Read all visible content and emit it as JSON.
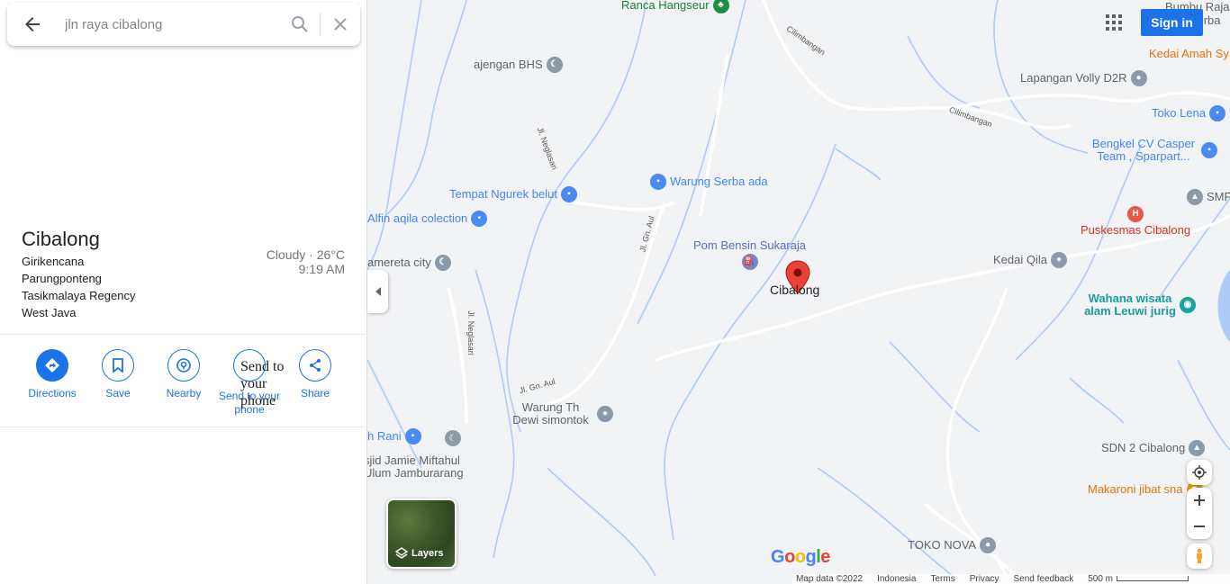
{
  "search": {
    "query": "jln raya cibalong"
  },
  "place": {
    "title": "Cibalong",
    "address_lines": [
      "Girikencana",
      "Parungponteng",
      "Tasikmalaya Regency",
      "West Java"
    ],
    "weather": "Cloudy · 26°C",
    "time": "9:19 AM"
  },
  "actions": [
    {
      "label": "Directions",
      "icon": "directions-icon"
    },
    {
      "label": "Save",
      "icon": "bookmark-icon"
    },
    {
      "label": "Nearby",
      "icon": "nearby-icon"
    },
    {
      "label": "Send to your phone",
      "icon": "send-to-phone-icon"
    },
    {
      "label": "Share",
      "icon": "share-icon"
    }
  ],
  "send_img_alt": "Send to your phone",
  "header": {
    "sign_in": "Sign in"
  },
  "layers": {
    "label": "Layers"
  },
  "map": {
    "pins": [
      {
        "label": "Ranca Hangseur",
        "style": "green"
      },
      {
        "label": "ajengan BHS",
        "style": "gray"
      },
      {
        "label": "Tempat Ngurek belut",
        "style": "blue"
      },
      {
        "label": "Warung Serba ada",
        "style": "blue"
      },
      {
        "label": "Alfin aqila colection",
        "style": "blue"
      },
      {
        "label": "Pom Bensin Sukaraja",
        "style": "indigo"
      },
      {
        "label": "Cibalong",
        "style": "red"
      },
      {
        "label": "amereta city",
        "style": "gray"
      },
      {
        "label": "Warung Th Dewi simontok",
        "style": "gray"
      },
      {
        "label": "h Rani",
        "style": "blue"
      },
      {
        "label": "sjid Jamie Miftahul Ulum Jamburarang",
        "style": "gray"
      },
      {
        "label": "Kedai Amah Sy",
        "style": "orange"
      },
      {
        "label": "Lapangan Volly D2R",
        "style": "gray"
      },
      {
        "label": "Toko Lena",
        "style": "blue"
      },
      {
        "label": "Bengkel CV Casper Team , Sparpart...",
        "style": "blue"
      },
      {
        "label": "SMF",
        "style": "gray"
      },
      {
        "label": "Puskesmas Cibalong",
        "style": "red"
      },
      {
        "label": "Kedai Qila",
        "style": "gray"
      },
      {
        "label": "Wahana wisata alam Leuwi jurig",
        "style": "teal"
      },
      {
        "label": "SDN 2 Cibalong",
        "style": "gray"
      },
      {
        "label": "Makaroni jibat sna",
        "style": "orange"
      },
      {
        "label": "TOKO NOVA",
        "style": "gray"
      },
      {
        "label": "Bumbu Raja( b",
        "style": "gray"
      },
      {
        "label": "serba",
        "style": "gray"
      }
    ],
    "roads": [
      "Cilimbangan",
      "Cilimbangan",
      "Jl. Neglasari",
      "Jl. Gn. Aul",
      "Jl. Neglasari",
      "Jl. Gn. Aul"
    ]
  },
  "footer": {
    "map_data": "Map data ©2022",
    "country": "Indonesia",
    "terms": "Terms",
    "privacy": "Privacy",
    "feedback": "Send feedback",
    "scale": "500 m"
  },
  "colors": {
    "accent": "#1a73e8",
    "water": "#8ab4f8",
    "marker": "#ea4335"
  }
}
